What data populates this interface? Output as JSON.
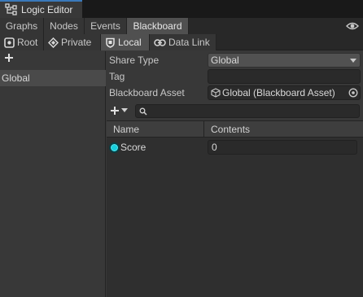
{
  "window": {
    "title": "Logic Editor",
    "icon": "logic-graph-icon"
  },
  "main_tabs": [
    {
      "label": "Graphs",
      "active": false
    },
    {
      "label": "Nodes",
      "active": false
    },
    {
      "label": "Events",
      "active": false
    },
    {
      "label": "Blackboard",
      "active": true
    }
  ],
  "visibility_toggle": {
    "icon": "eye-icon"
  },
  "sub_tabs": [
    {
      "label": "Root",
      "icon": "root-icon",
      "active": false
    },
    {
      "label": "Private",
      "icon": "diamond-icon",
      "active": false
    },
    {
      "label": "Local",
      "icon": "shield-icon",
      "active": true
    },
    {
      "label": "Data Link",
      "icon": "link-icon",
      "active": false
    }
  ],
  "left_panel": {
    "add_icon": "plus-icon",
    "items": [
      {
        "label": "Global",
        "selected": true
      }
    ]
  },
  "properties": {
    "share_type": {
      "label": "Share Type",
      "value": "Global"
    },
    "tag": {
      "label": "Tag",
      "value": ""
    },
    "blackboard_asset": {
      "label": "Blackboard Asset",
      "value": "Global (Blackboard Asset)"
    }
  },
  "variables_toolbar": {
    "add_icon": "plus-icon",
    "search_icon": "search-icon",
    "search_value": ""
  },
  "table": {
    "columns": [
      "Name",
      "Contents"
    ],
    "rows": [
      {
        "name": "Score",
        "value": "0",
        "type_color": "#18d0de"
      }
    ]
  },
  "colors": {
    "accent": "#3a79bb",
    "selected_tab": "#505050",
    "int_type": "#18d0de"
  }
}
